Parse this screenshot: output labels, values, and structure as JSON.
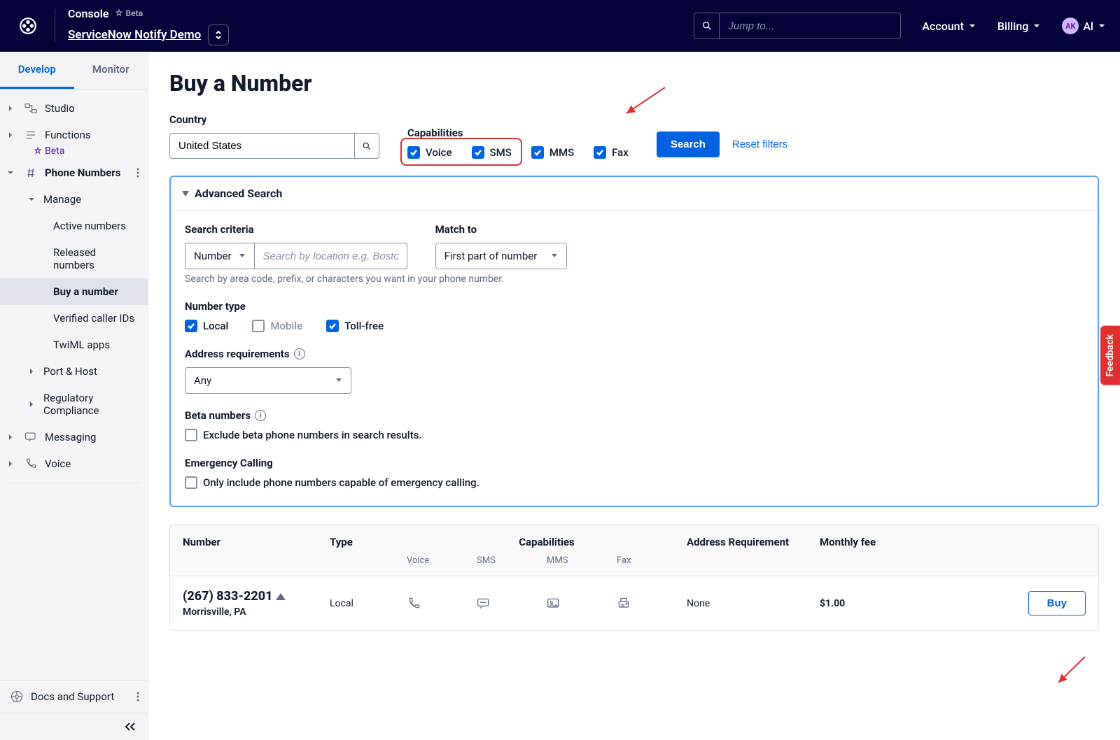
{
  "topbar": {
    "console_label": "Console",
    "beta_label": "Beta",
    "project_name": "ServiceNow Notify Demo",
    "search_placeholder": "Jump to...",
    "account_label": "Account",
    "billing_label": "Billing",
    "avatar_initials": "AK",
    "avatar_name": "Al"
  },
  "sidebar": {
    "tabs": {
      "develop": "Develop",
      "monitor": "Monitor"
    },
    "items": {
      "studio": "Studio",
      "functions": "Functions",
      "beta": "Beta",
      "phone_numbers": "Phone Numbers",
      "manage": "Manage",
      "active_numbers": "Active numbers",
      "released_numbers": "Released numbers",
      "buy_number": "Buy a number",
      "verified_caller": "Verified caller IDs",
      "twiml_apps": "TwiML apps",
      "port_host": "Port & Host",
      "regulatory": "Regulatory Compliance",
      "messaging": "Messaging",
      "voice": "Voice",
      "docs": "Docs and Support"
    }
  },
  "page": {
    "title": "Buy a Number",
    "country_label": "Country",
    "country_value": "United States",
    "capabilities_label": "Capabilities",
    "caps": {
      "voice": "Voice",
      "sms": "SMS",
      "mms": "MMS",
      "fax": "Fax"
    },
    "search_btn": "Search",
    "reset_btn": "Reset filters"
  },
  "advanced": {
    "title": "Advanced Search",
    "search_criteria_label": "Search criteria",
    "criteria_select": "Number",
    "criteria_placeholder": "Search by location e.g. Boston",
    "match_label": "Match to",
    "match_select": "First part of number",
    "hint": "Search by area code, prefix, or characters you want in your phone number.",
    "number_type_label": "Number type",
    "types": {
      "local": "Local",
      "mobile": "Mobile",
      "tollfree": "Toll-free"
    },
    "addr_req_label": "Address requirements",
    "addr_select": "Any",
    "beta_label": "Beta numbers",
    "beta_check": "Exclude beta phone numbers in search results.",
    "emergency_label": "Emergency Calling",
    "emergency_check": "Only include phone numbers capable of emergency calling."
  },
  "table": {
    "headers": {
      "number": "Number",
      "type": "Type",
      "capabilities": "Capabilities",
      "addr": "Address Requirement",
      "fee": "Monthly fee"
    },
    "subheaders": {
      "voice": "Voice",
      "sms": "SMS",
      "mms": "MMS",
      "fax": "Fax"
    },
    "rows": [
      {
        "number": "(267) 833-2201",
        "location": "Morrisville, PA",
        "type": "Local",
        "addr": "None",
        "fee": "$1.00",
        "buy": "Buy"
      }
    ]
  },
  "feedback_label": "Feedback"
}
